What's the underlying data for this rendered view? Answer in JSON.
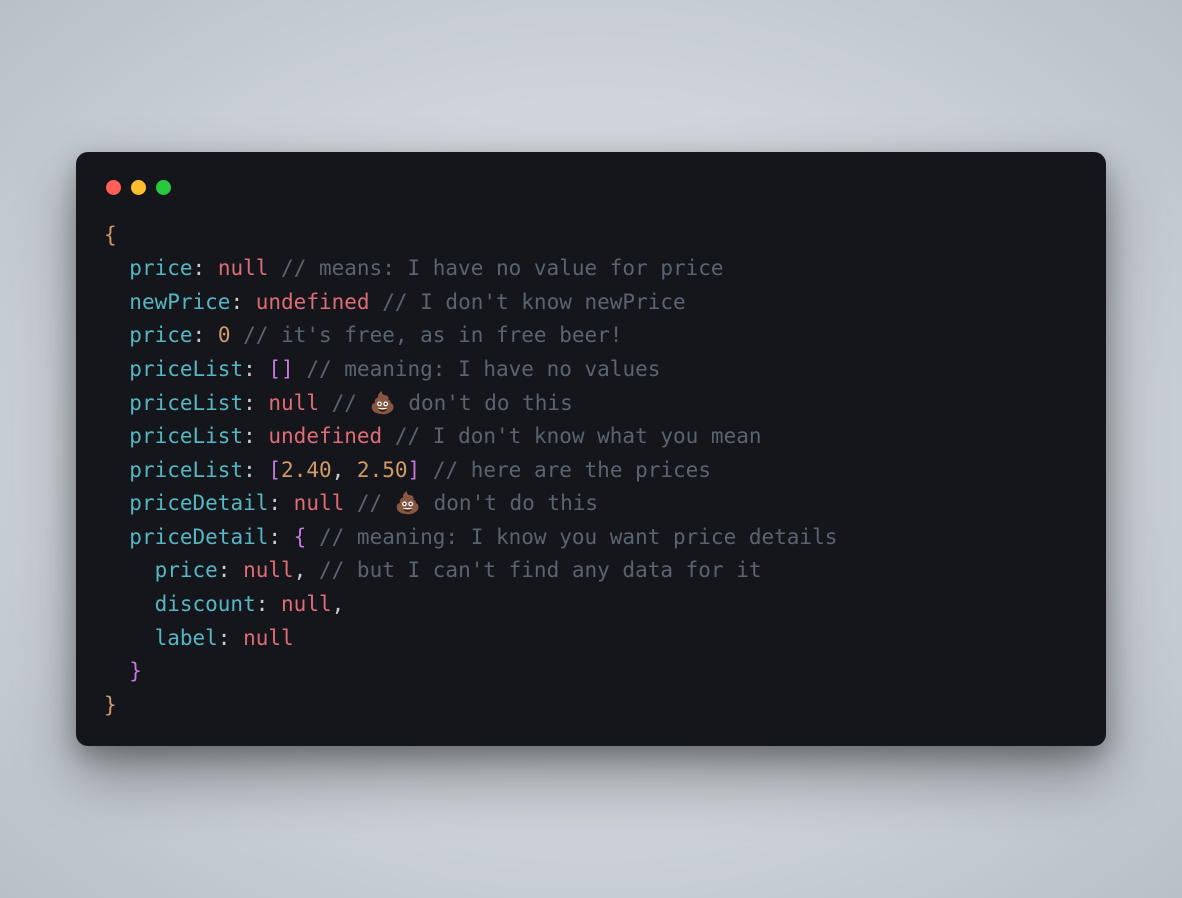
{
  "window": {
    "traffic_lights": [
      "close",
      "minimize",
      "zoom"
    ]
  },
  "code": {
    "indent1": "  ",
    "indent2": "    ",
    "open_brace": "{",
    "close_brace": "}",
    "open_bracket": "[",
    "close_bracket": "]",
    "colon_space": ": ",
    "comma": ",",
    "space": " ",
    "comma_space": ", ",
    "comment_prefix": "// ",
    "keys": {
      "price": "price",
      "newPrice": "newPrice",
      "priceList": "priceList",
      "priceDetail": "priceDetail",
      "discount": "discount",
      "label": "label"
    },
    "values": {
      "null": "null",
      "undefined": "undefined",
      "zero": "0",
      "list_a": "2.40",
      "list_b": "2.50"
    },
    "comments": {
      "l1": "means: I have no value for price",
      "l2": "I don't know newPrice",
      "l3": "it's free, as in free beer!",
      "l4": "meaning: I have no values",
      "l5": "💩 don't do this",
      "l6": "I don't know what you mean",
      "l7": "here are the prices",
      "l8": "💩 don't do this",
      "l9": "meaning: I know you want price details",
      "l10": "but I can't find any data for it"
    }
  }
}
